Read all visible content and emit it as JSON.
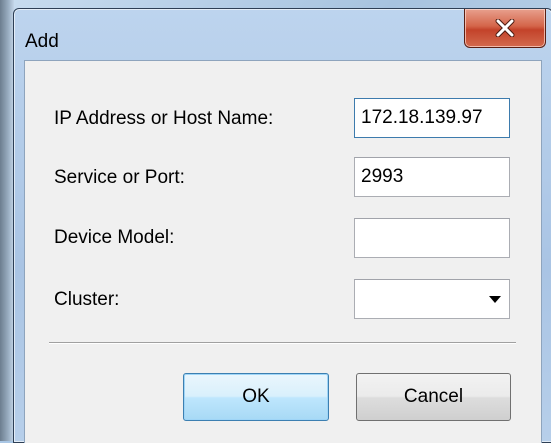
{
  "dialog": {
    "title": "Add",
    "close_icon": "close-icon"
  },
  "form": {
    "ip_label": "IP Address or Host Name:",
    "ip_value": "172.18.139.97",
    "port_label": "Service or Port:",
    "port_value": "2993",
    "model_label": "Device Model:",
    "model_value": "",
    "cluster_label": "Cluster:",
    "cluster_value": "",
    "cluster_arrow_icon": "chevron-down-icon"
  },
  "buttons": {
    "ok_label": "OK",
    "cancel_label": "Cancel"
  },
  "colors": {
    "close_button": "#c3432a",
    "default_button_border": "#3c7fb1",
    "window_frame": "#a9c4e4"
  }
}
